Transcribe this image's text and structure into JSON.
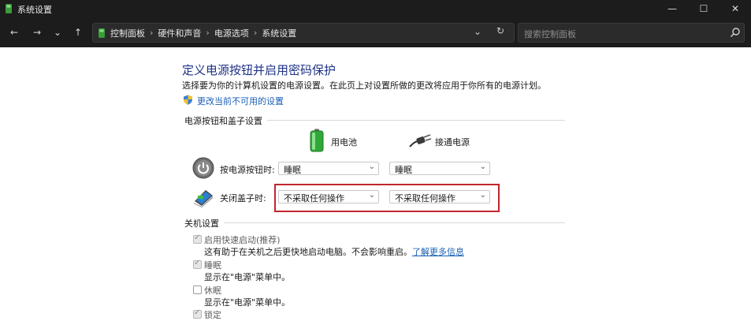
{
  "window": {
    "title": "系统设置",
    "minimize_glyph": "—",
    "maximize_glyph": "☐",
    "close_glyph": "✕"
  },
  "nav": {
    "back_glyph": "←",
    "forward_glyph": "→",
    "recent_glyph": "⌄",
    "up_glyph": "↑",
    "breadcrumbs": [
      "控制面板",
      "硬件和声音",
      "电源选项",
      "系统设置"
    ],
    "crumb_separator": "›",
    "dropdown_glyph": "⌄",
    "refresh_glyph": "↻"
  },
  "search": {
    "placeholder": "搜索控制面板"
  },
  "page": {
    "heading": "定义电源按钮并启用密码保护",
    "description": "选择要为你的计算机设置的电源设置。在此页上对设置所做的更改将应用于你所有的电源计划。",
    "change_link": "更改当前不可用的设置"
  },
  "power_section": {
    "title": "电源按钮和盖子设置",
    "columns": [
      "用电池",
      "接通电源"
    ],
    "rows": [
      {
        "label": "按电源按钮时:",
        "battery": "睡眠",
        "plugged": "睡眠"
      },
      {
        "label": "关闭盖子时:",
        "battery": "不采取任何操作",
        "plugged": "不采取任何操作"
      }
    ]
  },
  "shutdown_section": {
    "title": "关机设置",
    "options": [
      {
        "label": "启用快速启动(推荐)",
        "checked": true,
        "desc": "这有助于在关机之后更快地启动电脑。不会影响重启。",
        "link": "了解更多信息"
      },
      {
        "label": "睡眠",
        "checked": true,
        "desc": "显示在\"电源\"菜单中。"
      },
      {
        "label": "休眠",
        "checked": false,
        "desc": "显示在\"电源\"菜单中。"
      },
      {
        "label": "锁定",
        "checked": true
      }
    ]
  },
  "colors": {
    "titlebar_bg": "#1c1c1c",
    "heading": "#1e3287",
    "link": "#1a5fb4",
    "highlight_border": "#c0262d"
  },
  "icons": {
    "app": "control-panel-icon",
    "shield": "uac-shield-icon",
    "battery": "battery-icon",
    "plug": "plug-icon",
    "power": "power-button-icon",
    "lid": "laptop-lid-icon",
    "search": "search-icon"
  }
}
